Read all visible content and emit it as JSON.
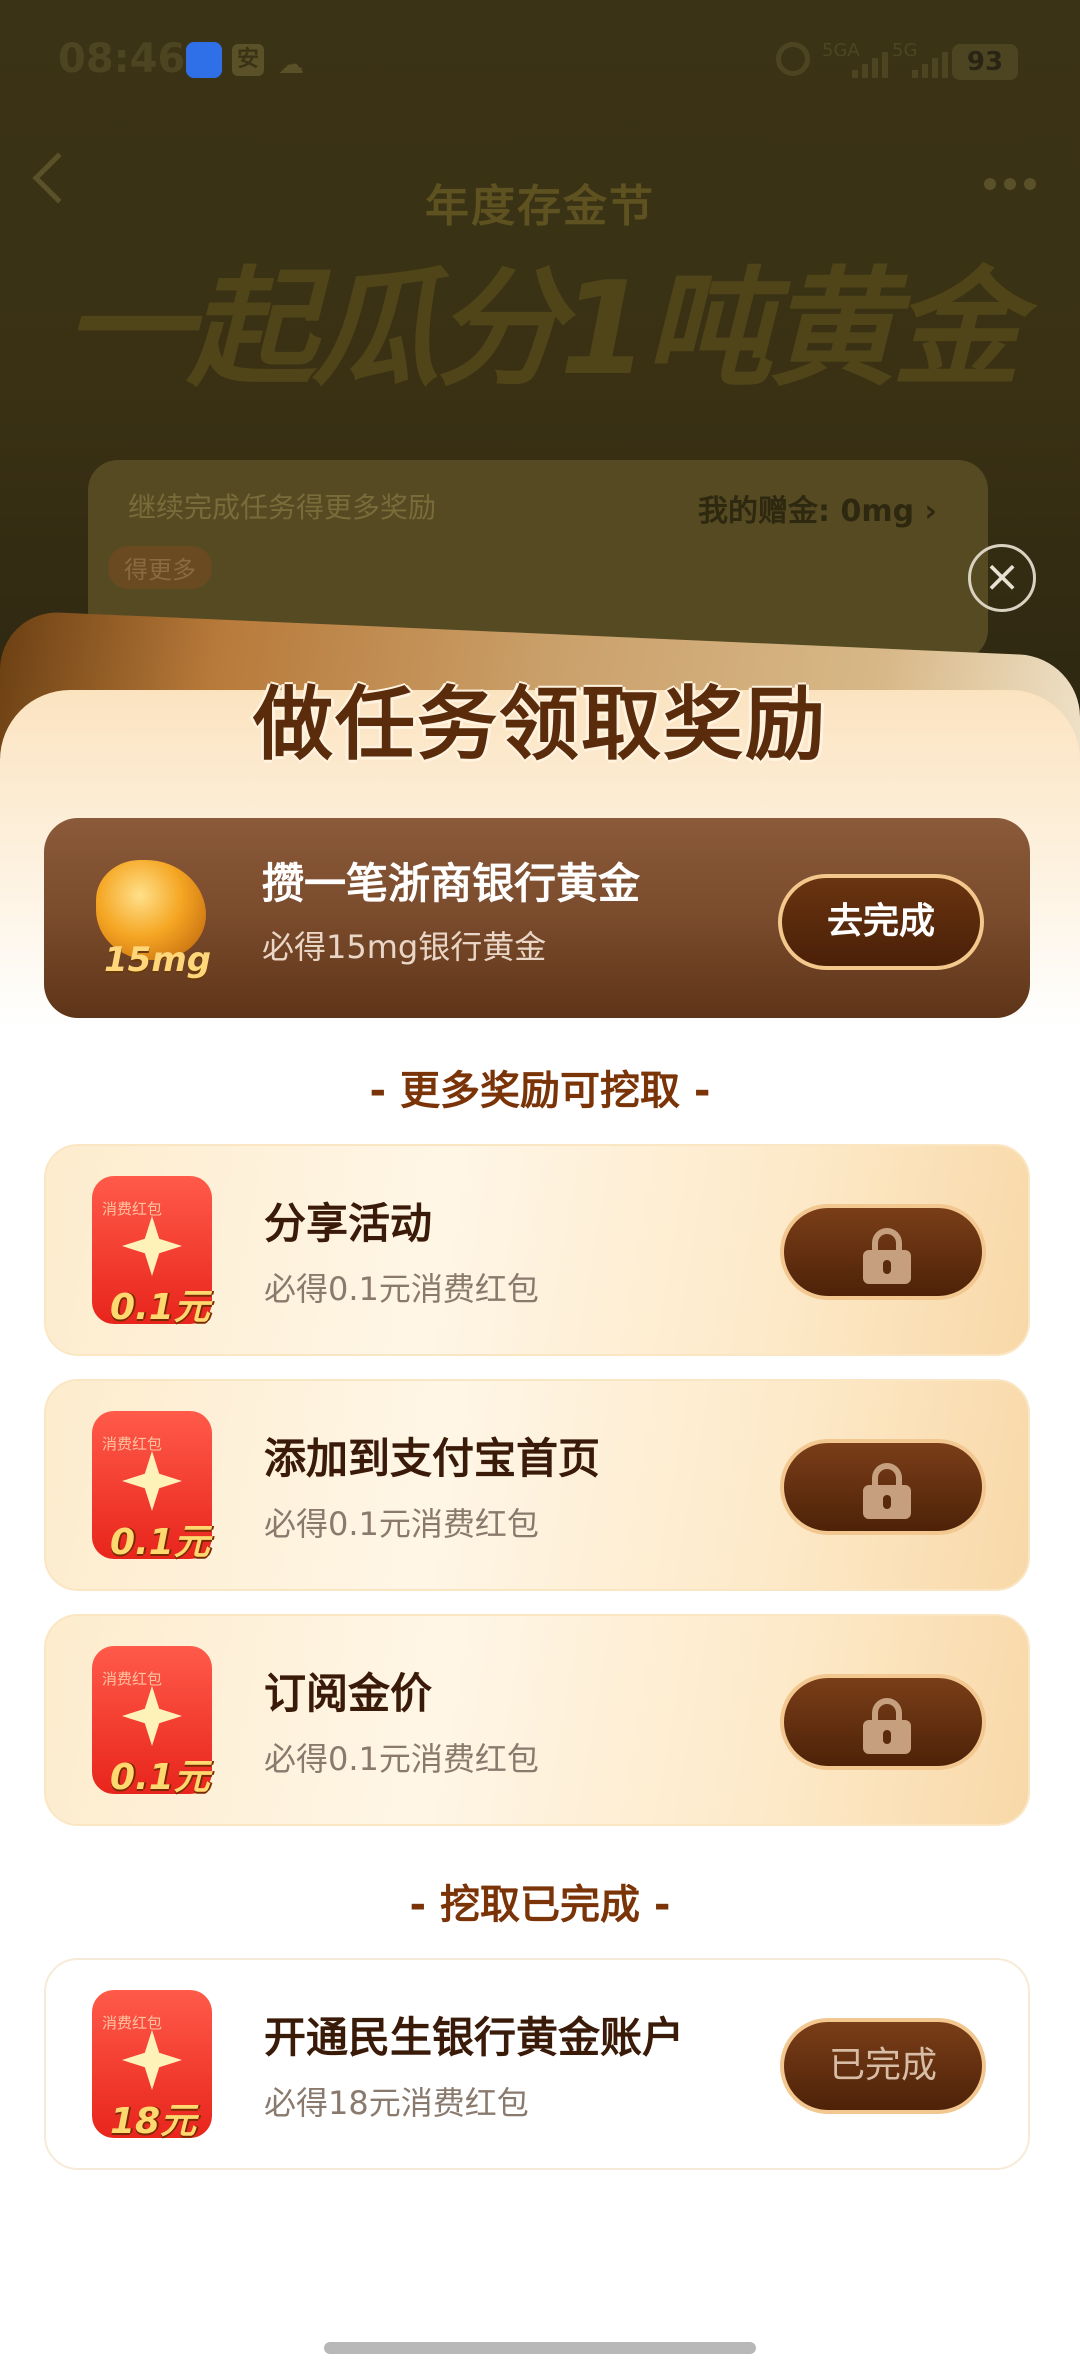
{
  "status_bar": {
    "time": "08:46",
    "signal_1": "5GA",
    "signal_2": "5G",
    "battery": "93",
    "app_badge": "安"
  },
  "background_page": {
    "festival_subtitle": "年度存金节",
    "festival_title": "一起瓜分1吨黄金",
    "card_text": "继续完成任务得更多奖励",
    "my_gift": "我的赠金: 0mg ›",
    "tag": "得更多"
  },
  "sheet": {
    "title": "做任务领取奖励",
    "featured": {
      "title": "攒一笔浙商银行黄金",
      "subtitle": "必得15mg银行黄金",
      "badge": "15mg",
      "button": "去完成"
    },
    "more_section": "- 更多奖励可挖取 -",
    "tasks": [
      {
        "title": "分享活动",
        "subtitle": "必得0.1元消费红包",
        "amount": "0.1元",
        "envelope_label": "消费红包"
      },
      {
        "title": "添加到支付宝首页",
        "subtitle": "必得0.1元消费红包",
        "amount": "0.1元",
        "envelope_label": "消费红包"
      },
      {
        "title": "订阅金价",
        "subtitle": "必得0.1元消费红包",
        "amount": "0.1元",
        "envelope_label": "消费红包"
      }
    ],
    "done_section": "- 挖取已完成 -",
    "done_tasks": [
      {
        "title": "开通民生银行黄金账户",
        "subtitle": "必得18元消费红包",
        "amount": "18元",
        "envelope_label": "消费红包",
        "button": "已完成"
      }
    ]
  },
  "icons": {
    "close": "close-icon",
    "lock": "lock-icon",
    "back": "back-arrow-icon",
    "more": "more-icon"
  },
  "colors": {
    "brown_dark": "#4e2208",
    "gold_border": "#f2c790",
    "title_brown": "#5a2c0c",
    "section_brown": "#7a3408"
  }
}
